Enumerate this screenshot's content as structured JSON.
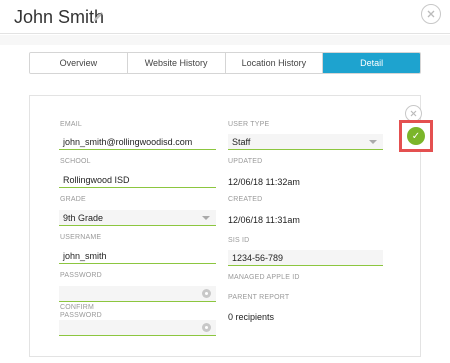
{
  "header": {
    "title": "John Smith",
    "edit_icon": "pencil-icon",
    "close_icon": "close-icon"
  },
  "tabs": [
    {
      "label": "Overview",
      "active": false
    },
    {
      "label": "Website History",
      "active": false
    },
    {
      "label": "Location History",
      "active": false
    },
    {
      "label": "Detail",
      "active": true
    }
  ],
  "form": {
    "email": {
      "label": "EMAIL",
      "value": "john_smith@rollingwoodisd.com"
    },
    "school": {
      "label": "SCHOOL",
      "value": "Rollingwood ISD"
    },
    "grade": {
      "label": "GRADE",
      "value": "9th Grade"
    },
    "username": {
      "label": "USERNAME",
      "value": "john_smith"
    },
    "password": {
      "label": "PASSWORD",
      "value": ""
    },
    "confirm_password": {
      "label_line1": "CONFIRM",
      "label_line2": "PASSWORD",
      "value": ""
    },
    "user_type": {
      "label": "USER TYPE",
      "value": "Staff"
    },
    "updated": {
      "label": "UPDATED",
      "value": "12/06/18 11:32am"
    },
    "created": {
      "label": "CREATED",
      "value": "12/06/18 11:31am"
    },
    "sis_id": {
      "label": "SIS ID",
      "value": "1234-56-789"
    },
    "managed_apple_id": {
      "label": "MANAGED APPLE ID",
      "value": ""
    },
    "parent_report": {
      "label": "PARENT REPORT",
      "value": "0 recipients"
    }
  },
  "save_button": {
    "glyph": "✓",
    "icon": "checkmark-icon",
    "color": "#7bb52a",
    "highlight_color": "#e45050"
  },
  "colors": {
    "accent": "#1ea3cf",
    "field_underline": "#8cc63f"
  }
}
